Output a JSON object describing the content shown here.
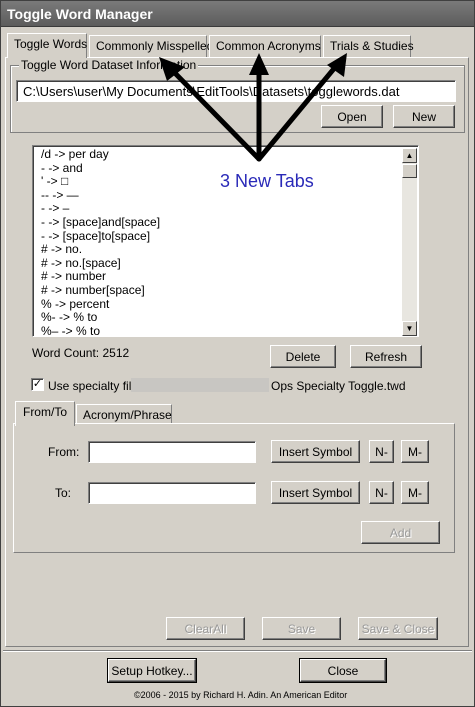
{
  "window": {
    "title": "Toggle Word Manager"
  },
  "main_tabs": [
    {
      "label": "Toggle Words",
      "active": true
    },
    {
      "label": "Commonly Misspelled",
      "active": false
    },
    {
      "label": "Common Acronyms",
      "active": false
    },
    {
      "label": "Trials & Studies",
      "active": false
    }
  ],
  "dataset": {
    "group_label": "Toggle Word Dataset Information",
    "path": "C:\\Users\\user\\My Documents\\EditTools\\Datasets\\togglewords.dat",
    "open_label": "Open",
    "new_label": "New"
  },
  "annotation": {
    "text": "3 New Tabs",
    "color": "#2a2ab8"
  },
  "word_list": {
    "items": [
      "/d ->  per day",
      "- ->  and",
      "' -> □",
      "-- -> —",
      "- -> –",
      "- -> [space]and[space]",
      "- -> [space]to[space]",
      "# -> no.",
      "# -> no.[space]",
      "# -> number",
      "# -> number[space]",
      "% ->  percent",
      "%- -> % to",
      "%– -> % to"
    ],
    "word_count_label": "Word Count: 2512",
    "delete_label": "Delete",
    "refresh_label": "Refresh"
  },
  "specialty": {
    "checked": true,
    "check_glyph": "✓",
    "label": "Use specialty file:",
    "file_suffix": "Ops Specialty Toggle.twd"
  },
  "sub_tabs": [
    {
      "label": "From/To",
      "active": true
    },
    {
      "label": "Acronym/Phrase",
      "active": false
    }
  ],
  "entry": {
    "from_label": "From:",
    "to_label": "To:",
    "from_value": "",
    "to_value": "",
    "insert_symbol_label": "Insert Symbol",
    "n_minus_label": "N-",
    "m_minus_label": "M-",
    "add_label": "Add"
  },
  "actions": {
    "clear_all_label": "ClearAll",
    "save_label": "Save",
    "save_close_label": "Save & Close"
  },
  "footer": {
    "setup_hotkey_label": "Setup Hotkey...",
    "close_label": "Close",
    "copyright": "©2006 - 2015 by Richard H. Adin. An American Editor"
  }
}
